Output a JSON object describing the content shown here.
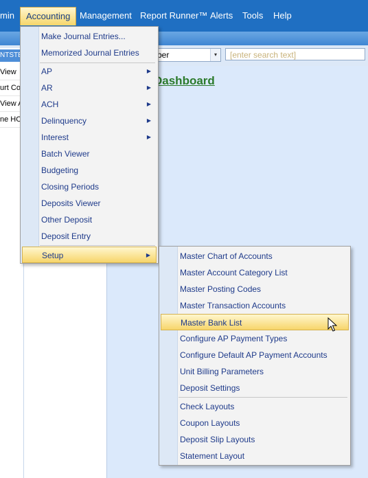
{
  "menubar": {
    "items": [
      "min",
      "Accounting",
      "Management",
      "Report Runner™",
      "Alerts",
      "Tools",
      "Help"
    ]
  },
  "toolbar": {
    "combo_value": "ber",
    "combo_arrow": "▾",
    "search_placeholder": "[enter search text]"
  },
  "left_pane": {
    "header": "NTSTE",
    "rows": [
      "View",
      "urt Cor",
      "View A",
      "ne HOA"
    ]
  },
  "main": {
    "dashboard_link": "Dashboard"
  },
  "accounting_menu": {
    "items": [
      {
        "label": "Make Journal Entries...",
        "submenu": false
      },
      {
        "label": "Memorized Journal Entries",
        "submenu": false
      },
      {
        "label": "AP",
        "submenu": true
      },
      {
        "label": "AR",
        "submenu": true
      },
      {
        "label": "ACH",
        "submenu": true
      },
      {
        "label": "Delinquency",
        "submenu": true
      },
      {
        "label": "Interest",
        "submenu": true
      },
      {
        "label": "Batch Viewer",
        "submenu": false
      },
      {
        "label": "Budgeting",
        "submenu": false
      },
      {
        "label": "Closing Periods",
        "submenu": false
      },
      {
        "label": "Deposits Viewer",
        "submenu": false
      },
      {
        "label": "Other Deposit",
        "submenu": false
      },
      {
        "label": "Deposit Entry",
        "submenu": false
      },
      {
        "label": "Setup",
        "submenu": true,
        "highlighted": true
      }
    ],
    "submenu_arrow": "▶"
  },
  "setup_menu": {
    "items": [
      "Master Chart of Accounts",
      "Master Account Category List",
      "Master Posting Codes",
      "Master Transaction Accounts",
      "Master Bank List",
      "Configure AP Payment Types",
      "Configure Default AP Payment Accounts",
      "Unit Billing Parameters",
      "Deposit Settings",
      "Check Layouts",
      "Coupon Layouts",
      "Deposit Slip Layouts",
      "Statement Layout"
    ],
    "highlighted": "Master Bank List"
  },
  "colors": {
    "menubar_bg": "#1f6fc2",
    "menu_text": "#1e3a8a",
    "highlight": "#f7d56a",
    "dashboard_link": "#2b7a2b",
    "content_bg": "#dbe9fb"
  }
}
